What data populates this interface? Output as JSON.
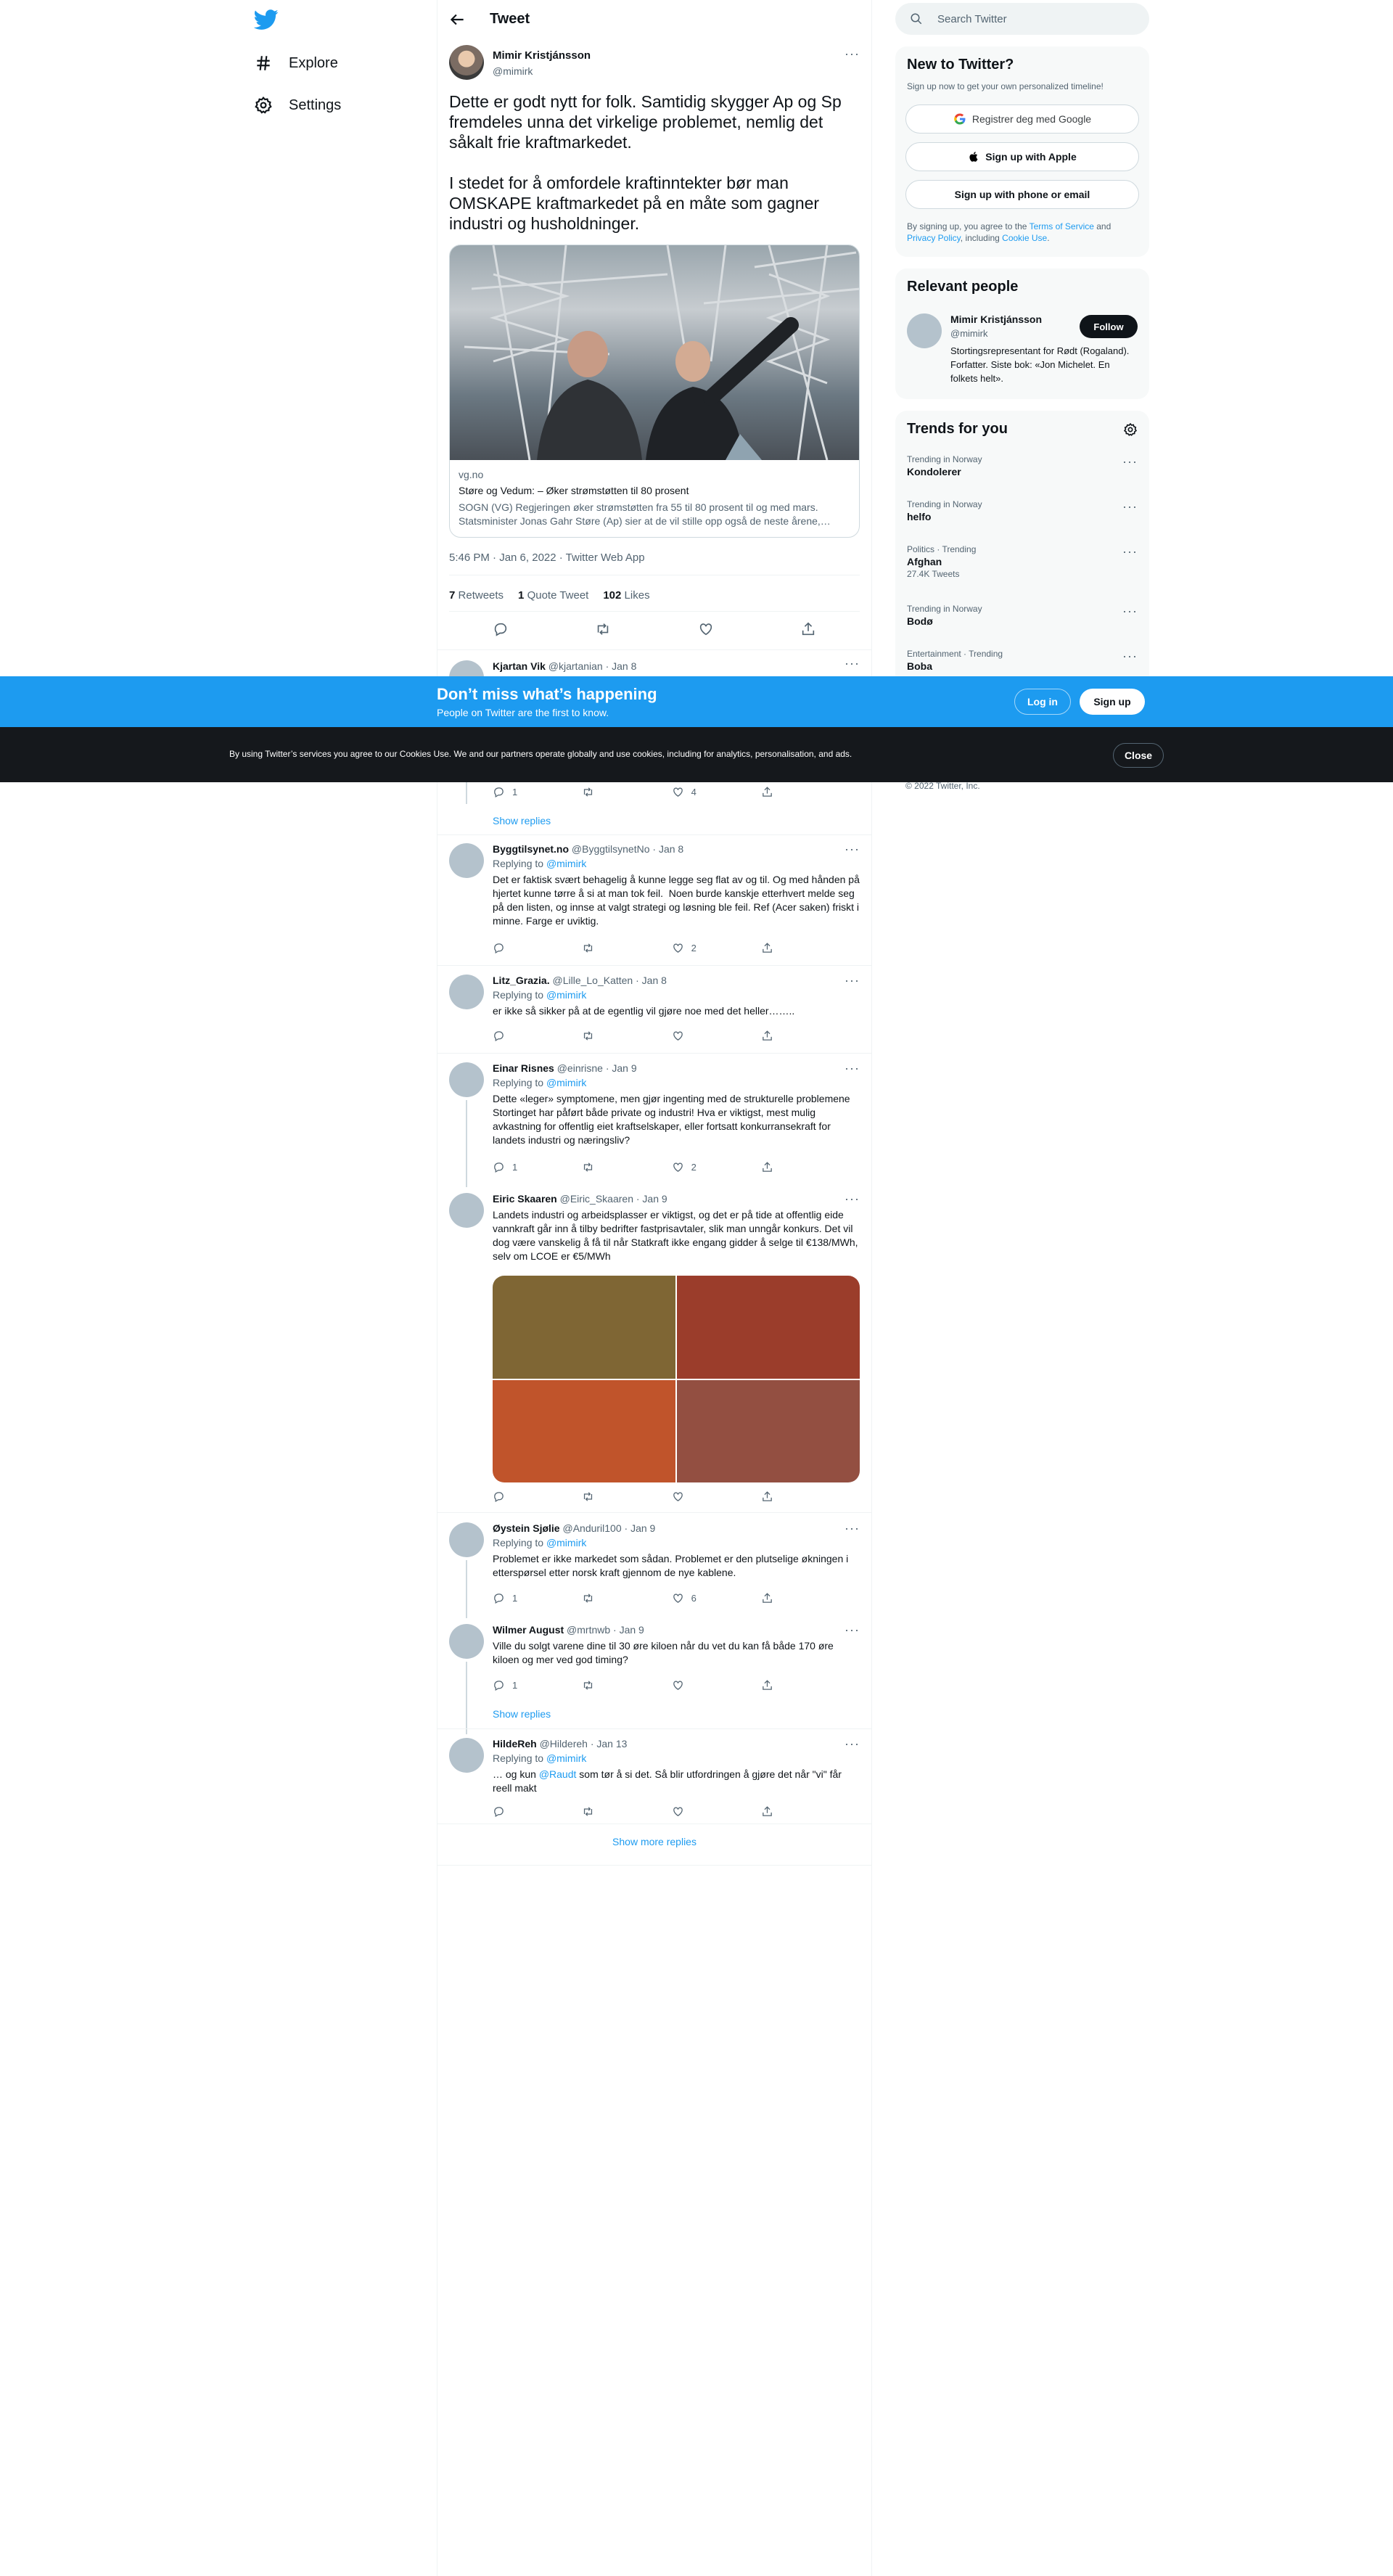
{
  "nav": {
    "explore": "Explore",
    "settings": "Settings"
  },
  "header": {
    "title": "Tweet"
  },
  "tweet": {
    "name": "Mimir Kristjánsson",
    "handle": "@mimirk",
    "text": "Dette er godt nytt for folk. Samtidig skygger Ap og Sp fremdeles unna det virkelige problemet, nemlig det såkalt frie kraftmarkedet.\n\nI stedet for å omfordele kraftinntekter bør man OMSKAPE kraftmarkedet på en måte som gagner industri og husholdninger.",
    "card": {
      "domain": "vg.no",
      "title": "Støre og Vedum: – Øker strømstøtten til 80 prosent",
      "description": "SOGN (VG) Regjeringen øker strømstøtten fra 55 til 80 prosent til og med mars. Statsminister Jonas Gahr Støre (Ap) sier at de vil stille opp også de neste årene,…"
    },
    "meta": "5:46 PM · Jan 6, 2022 · Twitter Web App",
    "retweets": "7",
    "retweets_label": "Retweets",
    "quotes": "1",
    "quotes_label": "Quote Tweet",
    "likes": "102",
    "likes_label": "Likes"
  },
  "replies": [
    {
      "name": "Kjartan Vik",
      "handle": "@kjartanian · Jan 8"
    },
    {
      "replies": "1",
      "retweets": "",
      "likes": "4",
      "show_replies": "Show replies"
    },
    {
      "name": "Byggtilsynet.no",
      "handle": "@ByggtilsynetNo · Jan 8",
      "replying": "Replying to",
      "to": "@mimirk",
      "text": "Det er faktisk svært behagelig å kunne legge seg flat av og til. Og med hånden på hjertet kunne tørre å si at man tok feil.  Noen burde kanskje etterhvert melde seg på den listen, og innse at valgt strategi og løsning ble feil. Ref (Acer saken) friskt i minne. Farge er uviktig.",
      "replies": "",
      "retweets": "",
      "likes": "2"
    },
    {
      "name": "Litz_Grazia.",
      "handle": "@Lille_Lo_Katten · Jan 8",
      "replying": "Replying to",
      "to": "@mimirk",
      "text": "er ikke så sikker på at de egentlig vil gjøre noe med det heller……..",
      "replies": "",
      "retweets": "",
      "likes": ""
    },
    {
      "name": "Einar Risnes",
      "handle": "@einrisne · Jan 9",
      "replying": "Replying to",
      "to": "@mimirk",
      "text": "Dette «leger» symptomene, men gjør ingenting med de strukturelle problemene Stortinget har påført både private og industri! Hva er viktigst, mest mulig avkastning for offentlig eiet kraftselskaper, eller fortsatt konkurransekraft for landets industri og næringsliv?",
      "replies": "1",
      "retweets": "",
      "likes": "2"
    },
    {
      "name": "Eiric Skaaren",
      "handle": "@Eiric_Skaaren · Jan 9",
      "text": "Landets industri og arbeidsplasser er viktigst, og det er på tide at offentlig eide vannkraft går inn å tilby bedrifter fastprisavtaler, slik man unngår konkurs. Det vil dog være vanskelig å få til når Statkraft ikke engang gidder å selge til €138/MWh, selv om LCOE er €5/MWh",
      "replies": "",
      "retweets": "",
      "likes": ""
    },
    {
      "name": "Øystein Sjølie",
      "handle": "@Anduril100 · Jan 9",
      "replying": "Replying to",
      "to": "@mimirk",
      "text": "Problemet er ikke markedet som sådan. Problemet er den plutselige økningen i etterspørsel etter norsk kraft gjennom de nye kablene.",
      "replies": "1",
      "retweets": "",
      "likes": "6"
    },
    {
      "name": "Wilmer August",
      "handle": "@mrtnwb · Jan 9",
      "text": "Ville du solgt varene dine til 30 øre kiloen når du vet du kan få både 170 øre kiloen og mer ved god timing?",
      "replies": "1",
      "retweets": "",
      "likes": "",
      "show_replies": "Show replies"
    },
    {
      "name": "HildeReh",
      "handle": "@Hildereh · Jan 13",
      "replying": "Replying to",
      "to": "@mimirk",
      "text_pre": "… og kun ",
      "mention": "@Raudt",
      "text_post": " som tør å si det. Så blir utfordringen å gjøre det når \"vi\" får reell makt",
      "replies": "",
      "retweets": "",
      "likes": ""
    }
  ],
  "show_more": "Show more replies",
  "search": {
    "placeholder": "Search Twitter"
  },
  "new_to_twitter": {
    "title": "New to Twitter?",
    "subtitle": "Sign up now to get your own personalized timeline!",
    "google": "Registrer deg med Google",
    "apple": "Sign up with Apple",
    "phone": "Sign up with phone or email",
    "legal_1": "By signing up, you agree to the ",
    "tos": "Terms of Service",
    "legal_2": " and ",
    "privacy": "Privacy Policy",
    "legal_3": ", including ",
    "cookie": "Cookie Use",
    "legal_4": "."
  },
  "relevant": {
    "title": "Relevant people",
    "name": "Mimir Kristjánsson",
    "handle": "@mimirk",
    "follow": "Follow",
    "bio": "Stortingsrepresentant for Rødt (Rogaland). Forfatter. Siste bok: «Jon Michelet. En folkets helt»."
  },
  "trends": {
    "title": "Trends for you",
    "items": [
      {
        "cat": "Trending in Norway",
        "name": "Kondolerer",
        "count": ""
      },
      {
        "cat": "Trending in Norway",
        "name": "helfo",
        "count": ""
      },
      {
        "cat": "Politics · Trending",
        "name": "Afghan",
        "count": "27.4K Tweets"
      },
      {
        "cat": "Trending in Norway",
        "name": "Bodø",
        "count": ""
      },
      {
        "cat": "Entertainment · Trending",
        "name": "Boba",
        "count": ""
      }
    ]
  },
  "footer": {
    "copyright": "© 2022 Twitter, Inc."
  },
  "banner": {
    "title": "Don’t miss what’s happening",
    "subtitle": "People on Twitter are the first to know.",
    "login": "Log in",
    "signup": "Sign up"
  },
  "cookie_bar": {
    "text": "By using Twitter’s services you agree to our Cookies Use. We and our partners operate globally and use cookies, including for analytics, personalisation, and ads.",
    "close": "Close"
  },
  "colors": {
    "accent": "#1d9bf0",
    "text": "#0f1419",
    "muted": "#536471",
    "img1": "#7f6634",
    "img2": "#9b3d2b",
    "img3": "#c0542b",
    "img4": "#934f41"
  }
}
